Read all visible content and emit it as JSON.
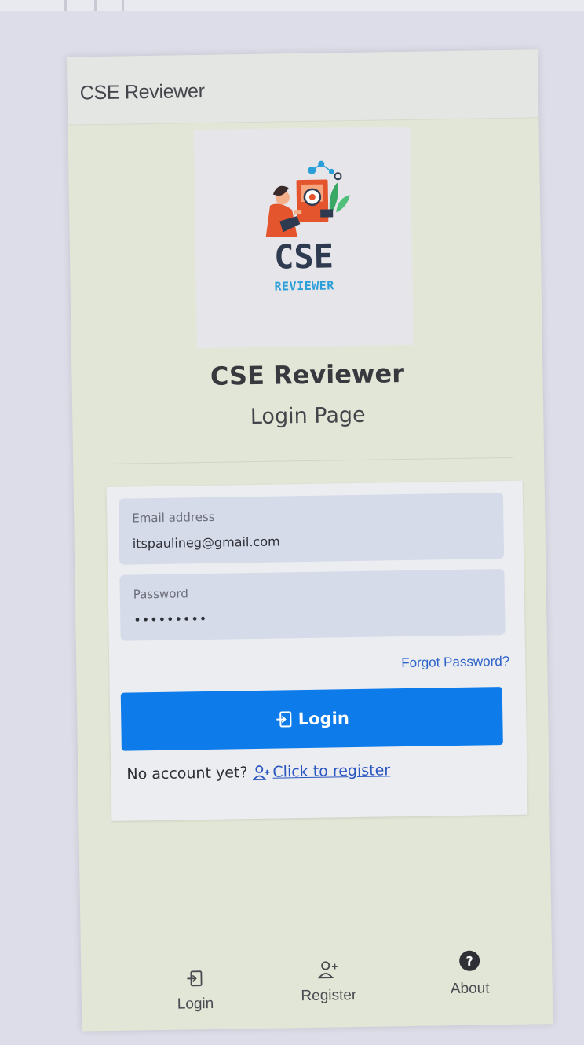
{
  "window": {
    "title": "CSE Reviewer"
  },
  "logo": {
    "brand_main": "CSE",
    "brand_sub": "REVIEWER"
  },
  "heading": {
    "title": "CSE Reviewer",
    "subtitle": "Login Page"
  },
  "form": {
    "email_label": "Email address",
    "email_value": "itspaulineg@gmail.com",
    "password_label": "Password",
    "password_value": "•••••••••",
    "forgot_link": "Forgot Password?",
    "login_button": "Login",
    "no_account_text": "No account yet?",
    "register_link": "Click to register"
  },
  "tabbar": {
    "tabs": [
      {
        "label": "Login",
        "icon": "login-icon"
      },
      {
        "label": "Register",
        "icon": "register-icon"
      },
      {
        "label": "About",
        "icon": "help-circle-icon"
      }
    ]
  },
  "colors": {
    "primary": "#0d7bea",
    "link": "#2a56c0",
    "app_background": "#e2e6d6",
    "card_background": "#ecedf1",
    "field_background": "#d6dbea",
    "logo_accent": "#e4552d",
    "logo_text": "#2e3a4f",
    "logo_subtext": "#2a9fd8"
  }
}
